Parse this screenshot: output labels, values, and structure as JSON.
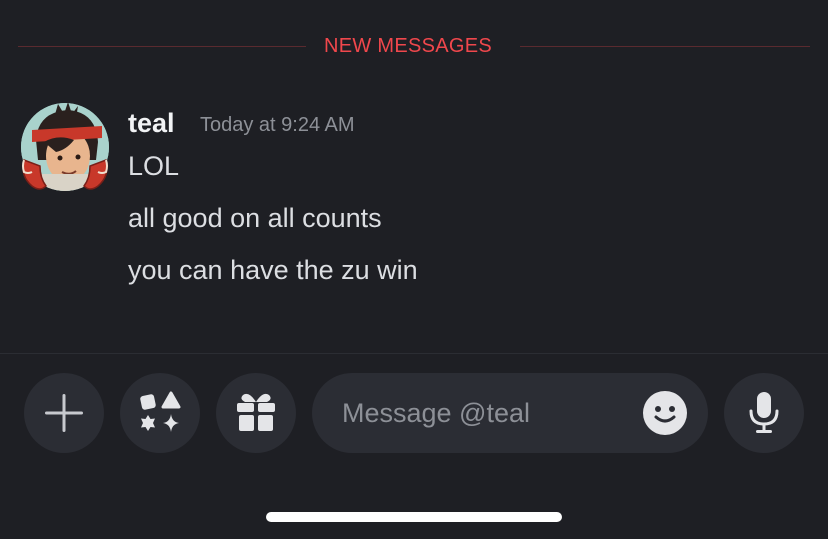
{
  "divider": {
    "label": "NEW MESSAGES"
  },
  "message": {
    "author": "teal",
    "timestamp": "Today at 9:24 AM",
    "lines": [
      "LOL",
      "all good on all counts",
      "you can have the zu win"
    ]
  },
  "composer": {
    "placeholder": "Message @teal",
    "value": "",
    "icons": [
      "plus-icon",
      "apps-icon",
      "gift-icon",
      "emoji-icon",
      "microphone-icon"
    ]
  },
  "colors": {
    "background": "#1e1f24",
    "new_messages": "#f0474c",
    "button_bg": "#2b2d34",
    "text_primary": "#f2f3f5",
    "text_muted": "#8d9097"
  }
}
